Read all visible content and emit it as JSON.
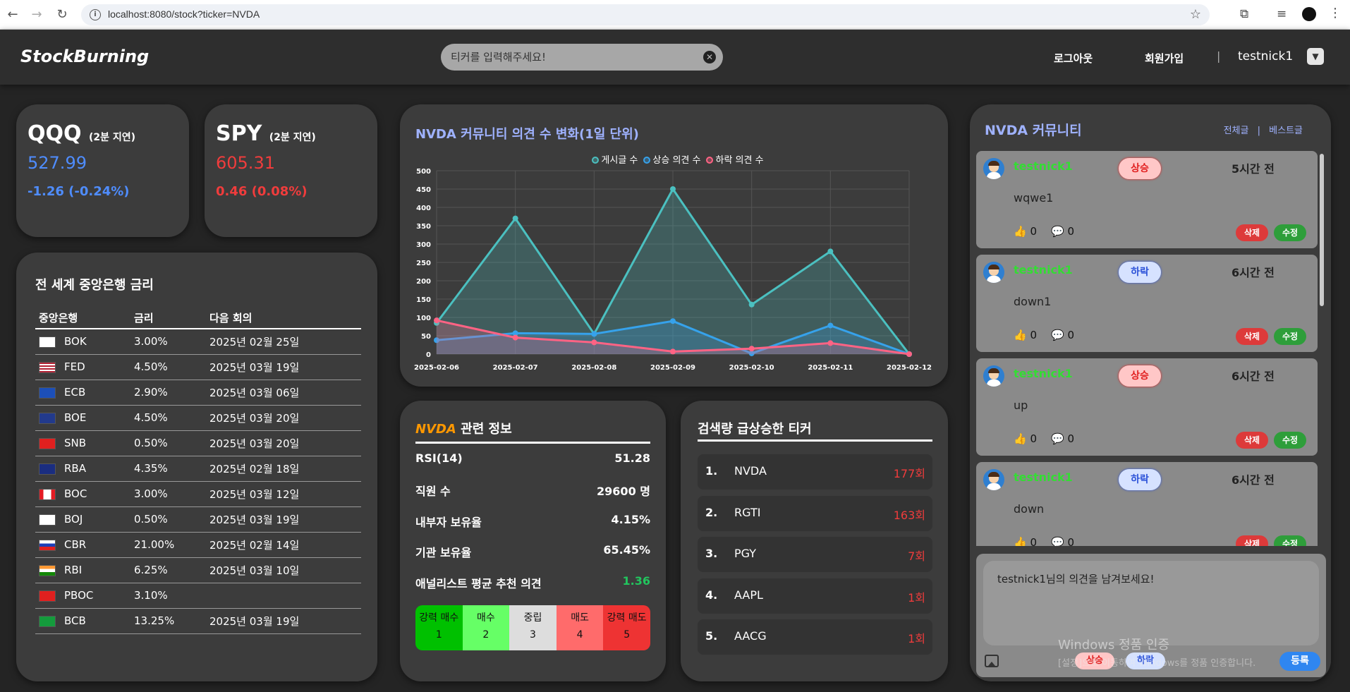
{
  "browser": {
    "url": "localhost:8080/stock?ticker=NVDA"
  },
  "header": {
    "logo": "StockBurning",
    "search_placeholder": "티커를 입력해주세요!",
    "logout": "로그아웃",
    "signup": "회원가입",
    "separator": "|",
    "nickname": "testnick1"
  },
  "quotes": [
    {
      "ticker": "QQQ",
      "delay": "(2분 지연)",
      "price": "527.99",
      "change": "-1.26 (-0.24%)",
      "color": "#4f8dff"
    },
    {
      "ticker": "SPY",
      "delay": "(2분 지연)",
      "price": "605.31",
      "change": "0.46 (0.08%)",
      "color": "#f03c3c"
    }
  ],
  "central_banks": {
    "title": "전 세계 중앙은행 금리",
    "headers": [
      "중앙은행",
      "금리",
      "다음 회의"
    ],
    "rows": [
      {
        "code": "BOK",
        "rate": "3.00%",
        "next": "2025년 02월 25일",
        "flag": "kr"
      },
      {
        "code": "FED",
        "rate": "4.50%",
        "next": "2025년 03월 19일",
        "flag": "us"
      },
      {
        "code": "ECB",
        "rate": "2.90%",
        "next": "2025년 03월 06일",
        "flag": "eu"
      },
      {
        "code": "BOE",
        "rate": "4.50%",
        "next": "2025년 03월 20일",
        "flag": "gb"
      },
      {
        "code": "SNB",
        "rate": "0.50%",
        "next": "2025년 03월 20일",
        "flag": "ch"
      },
      {
        "code": "RBA",
        "rate": "4.35%",
        "next": "2025년 02월 18일",
        "flag": "au"
      },
      {
        "code": "BOC",
        "rate": "3.00%",
        "next": "2025년 03월 12일",
        "flag": "ca"
      },
      {
        "code": "BOJ",
        "rate": "0.50%",
        "next": "2025년 03월 19일",
        "flag": "jp"
      },
      {
        "code": "CBR",
        "rate": "21.00%",
        "next": "2025년 02월 14일",
        "flag": "ru"
      },
      {
        "code": "RBI",
        "rate": "6.25%",
        "next": "2025년 03월 10일",
        "flag": "in"
      },
      {
        "code": "PBOC",
        "rate": "3.10%",
        "next": "",
        "flag": "cn"
      },
      {
        "code": "BCB",
        "rate": "13.25%",
        "next": "2025년 03월 19일",
        "flag": "br"
      }
    ]
  },
  "chart_data": {
    "type": "area",
    "title": "NVDA 커뮤니티 의견 수 변화(1일 단위)",
    "x": [
      "2025-02-06",
      "2025-02-07",
      "2025-02-08",
      "2025-02-09",
      "2025-02-10",
      "2025-02-11",
      "2025-02-12"
    ],
    "ylim": [
      0,
      500
    ],
    "yticks": [
      0,
      50,
      100,
      150,
      200,
      250,
      300,
      350,
      400,
      450,
      500
    ],
    "grid": true,
    "legend_position": "top",
    "series": [
      {
        "name": "게시글 수",
        "color": "#4bc0c0",
        "values": [
          85,
          370,
          55,
          450,
          135,
          280,
          0
        ]
      },
      {
        "name": "상승 의견 수",
        "color": "#36a2eb",
        "values": [
          38,
          57,
          55,
          90,
          2,
          78,
          0
        ]
      },
      {
        "name": "하락 의견 수",
        "color": "#ff6384",
        "values": [
          92,
          45,
          32,
          7,
          15,
          30,
          0
        ]
      }
    ]
  },
  "info": {
    "ticker": "NVDA",
    "title_suffix": "관련 정보",
    "rows": [
      {
        "label": "RSI(14)",
        "value": "51.28"
      },
      {
        "label": "직원 수",
        "value": "29600 명"
      },
      {
        "label": "내부자 보유율",
        "value": "4.15%"
      },
      {
        "label": "기관 보유율",
        "value": "65.45%"
      },
      {
        "label": "애널리스트 평균 추천 의견",
        "value": "1.36"
      }
    ],
    "analyst_color": "#22c55e",
    "scale": [
      {
        "label": "강력 매수",
        "num": "1",
        "color": "#00c000"
      },
      {
        "label": "매수",
        "num": "2",
        "color": "#66ff66"
      },
      {
        "label": "중립",
        "num": "3",
        "color": "#dddddd"
      },
      {
        "label": "매도",
        "num": "4",
        "color": "#ff6b6b"
      },
      {
        "label": "강력 매도",
        "num": "5",
        "color": "#ee3333"
      }
    ]
  },
  "trending": {
    "title": "검색량 급상승한 티커",
    "items": [
      {
        "rank": "1.",
        "ticker": "NVDA",
        "count": "177회"
      },
      {
        "rank": "2.",
        "ticker": "RGTI",
        "count": "163회"
      },
      {
        "rank": "3.",
        "ticker": "PGY",
        "count": "7회"
      },
      {
        "rank": "4.",
        "ticker": "AAPL",
        "count": "1회"
      },
      {
        "rank": "5.",
        "ticker": "AACG",
        "count": "1회"
      }
    ]
  },
  "community": {
    "title": "NVDA 커뮤니티",
    "all_link": "전체글",
    "sep": "|",
    "best_link": "베스트글",
    "posts": [
      {
        "user": "testnick1",
        "opinion": "상승",
        "type": "up",
        "time": "5시간 전",
        "body": "wqwe1",
        "likes": "0",
        "comments": "0"
      },
      {
        "user": "testnick1",
        "opinion": "하락",
        "type": "down",
        "time": "6시간 전",
        "body": "down1",
        "likes": "0",
        "comments": "0"
      },
      {
        "user": "testnick1",
        "opinion": "상승",
        "type": "up",
        "time": "6시간 전",
        "body": "up",
        "likes": "0",
        "comments": "0"
      },
      {
        "user": "testnick1",
        "opinion": "하락",
        "type": "down",
        "time": "6시간 전",
        "body": "down",
        "likes": "0",
        "comments": "0"
      }
    ],
    "delete_label": "삭제",
    "edit_label": "수정",
    "compose_placeholder": "testnick1님의 의견을 남겨보세요!",
    "up_label": "상승",
    "down_label": "하락",
    "submit_label": "등록"
  },
  "watermark": {
    "line1": "Windows 정품 인증",
    "line2": "[설정]으로 이동하여 Windows를 정품 인증합니다."
  }
}
